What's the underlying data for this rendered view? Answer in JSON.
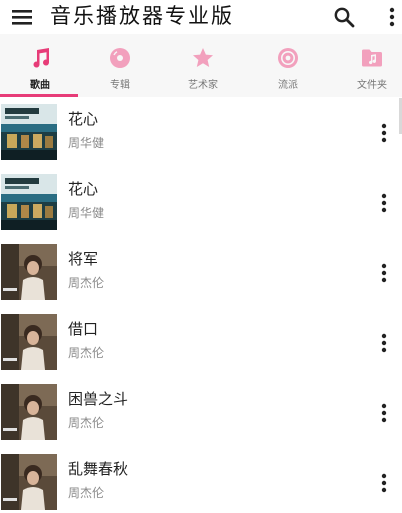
{
  "app": {
    "title": "音乐播放器专业版"
  },
  "icons": {
    "menu": "hamburger-menu-icon",
    "search": "search-icon",
    "overflow": "more-vertical-icon"
  },
  "colors": {
    "accent": "#e73c78",
    "tab_icon": "#f2a0bd",
    "cover_blue_a": "#2a6d83",
    "cover_warm_b": "#8b6a4a"
  },
  "tabs": [
    {
      "label": "歌曲",
      "icon": "music-note-icon",
      "active": true
    },
    {
      "label": "专辑",
      "icon": "album-disc-icon",
      "active": false
    },
    {
      "label": "艺术家",
      "icon": "star-icon",
      "active": false
    },
    {
      "label": "流派",
      "icon": "genre-vinyl-icon",
      "active": false
    },
    {
      "label": "文件夹",
      "icon": "music-folder-icon",
      "active": false
    }
  ],
  "songs": [
    {
      "title": "花心",
      "artist": "周华健",
      "cover": "album-cover-a"
    },
    {
      "title": "花心",
      "artist": "周华健",
      "cover": "album-cover-a"
    },
    {
      "title": "将军",
      "artist": "周杰伦",
      "cover": "album-cover-b"
    },
    {
      "title": "借口",
      "artist": "周杰伦",
      "cover": "album-cover-b"
    },
    {
      "title": "困兽之斗",
      "artist": "周杰伦",
      "cover": "album-cover-b"
    },
    {
      "title": "乱舞春秋",
      "artist": "周杰伦",
      "cover": "album-cover-b"
    }
  ]
}
